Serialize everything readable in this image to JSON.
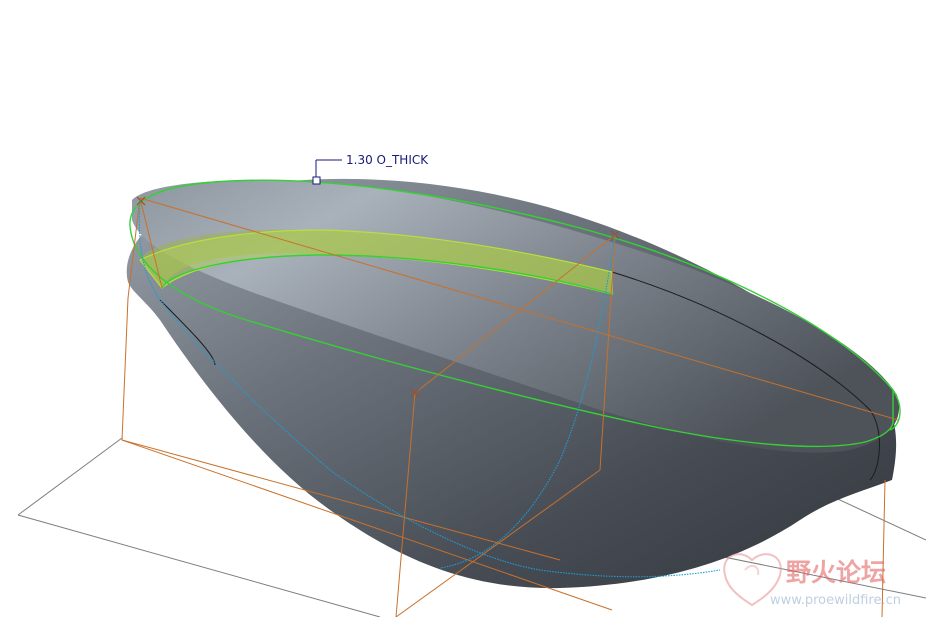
{
  "viewport": {
    "dimension_label": "1.30 O_THICK"
  },
  "watermark": {
    "title": "野火论坛",
    "url": "www.proewildfire.cn"
  },
  "colors": {
    "background": "#ffffff",
    "shell_dark": "#3a3f46",
    "shell_light": "#a7afb8",
    "selection_edge": "#35d035",
    "highlight_fill": "#b6e03a",
    "datum_plane": "#c8712b",
    "sketch_curve": "#1a9ed8",
    "dimension_text": "#1a1a7a",
    "watermark_title": "#e35a5a",
    "watermark_url": "#8aa8c8"
  }
}
